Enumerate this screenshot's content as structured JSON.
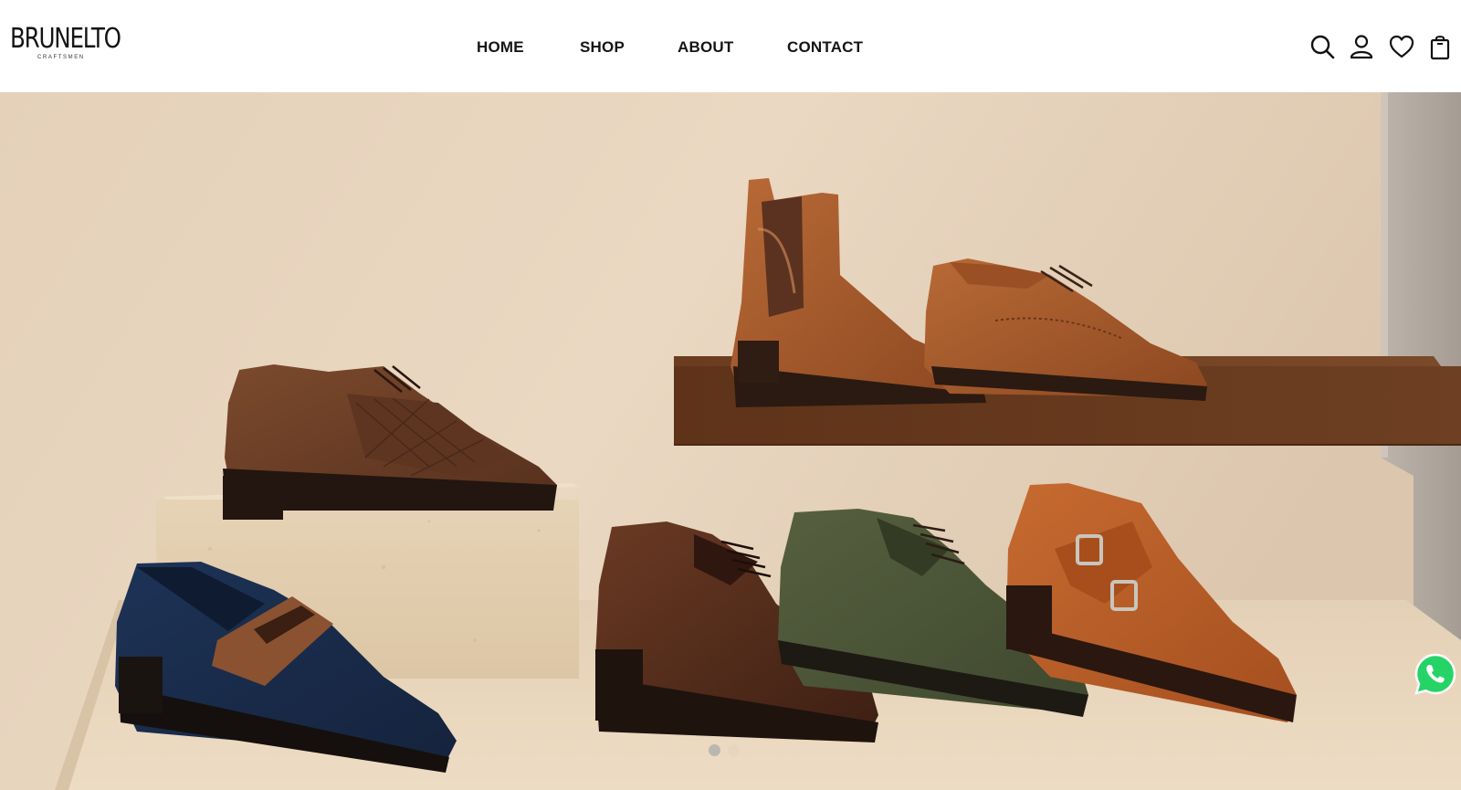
{
  "brand": {
    "name": "BRUNELTO",
    "tagline": "CRAFTSMEN"
  },
  "nav": {
    "items": [
      {
        "label": "HOME"
      },
      {
        "label": "SHOP"
      },
      {
        "label": "ABOUT"
      },
      {
        "label": "CONTACT"
      }
    ]
  },
  "header_icons": [
    "search-icon",
    "account-icon",
    "wishlist-heart-icon",
    "shopping-bag-icon"
  ],
  "hero": {
    "slider": {
      "slide_count": 2,
      "active_slide": 1
    },
    "colors": {
      "wall": "#e6d2bb",
      "shelf_wood": "#6d3f22",
      "platform": "#e9d6bd",
      "stone_block": "#e3cfb0"
    },
    "products_pictured": [
      "chelsea-boot-tan",
      "wingtip-derby-tan",
      "woven-wingtip-derby-dark-brown",
      "penny-loafer-navy-suede",
      "derby-dark-brown",
      "derby-olive-suede",
      "double-monk-strap-rust-suede"
    ]
  },
  "floating": {
    "whatsapp_color": "#25d366"
  }
}
